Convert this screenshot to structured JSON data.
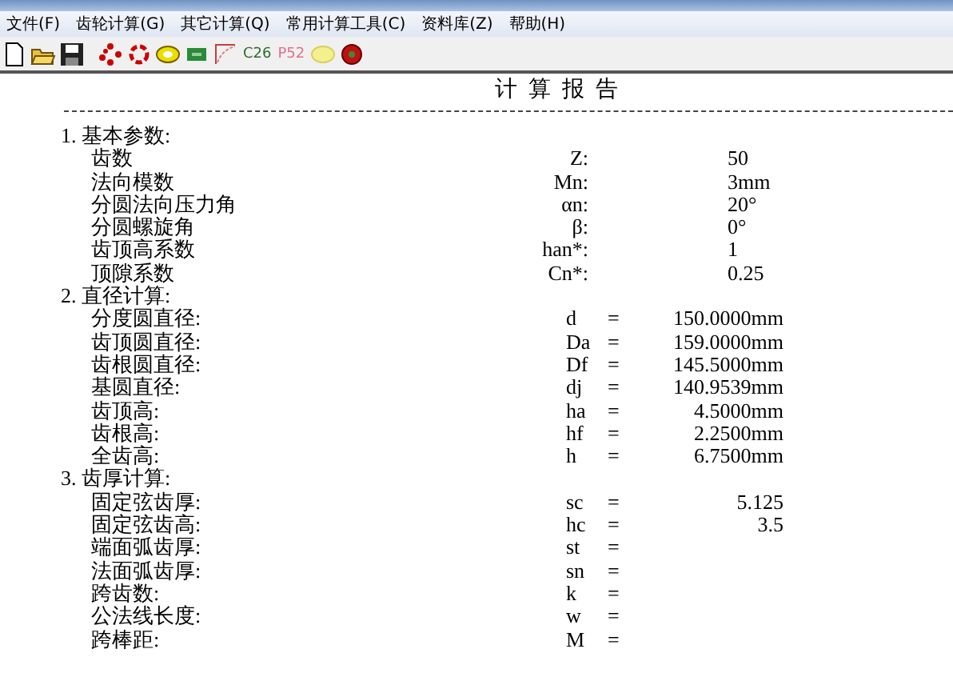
{
  "menu": [
    "文件(F)",
    "齿轮计算(G)",
    "其它计算(Q)",
    "常用计算工具(C)",
    "资料库(Z)",
    "帮助(H)"
  ],
  "toolbar": [
    {
      "kind": "new"
    },
    {
      "kind": "open"
    },
    {
      "kind": "save"
    },
    {
      "kind": "dots"
    },
    {
      "kind": "ring"
    },
    {
      "kind": "yellow"
    },
    {
      "kind": "green"
    },
    {
      "kind": "curve"
    },
    {
      "kind": "text",
      "text": "C26",
      "color": "#2e6b2e"
    },
    {
      "kind": "text",
      "text": "P52",
      "color": "#e07090"
    },
    {
      "kind": "yellow-pale"
    },
    {
      "kind": "red"
    }
  ],
  "report": {
    "title": "计  算  报  告",
    "sections": [
      {
        "heading": "1. 基本参数:",
        "kind": "colon",
        "rows": [
          {
            "label": "齿数",
            "symbol": "Z:",
            "value": "50"
          },
          {
            "label": "法向模数",
            "symbol": "Mn:",
            "value": "3mm"
          },
          {
            "label": "分圆法向压力角",
            "symbol": "αn:",
            "value": "20°"
          },
          {
            "label": "分圆螺旋角",
            "symbol": "β:",
            "value": "0°"
          },
          {
            "label": "齿顶高系数",
            "symbol": "han*:",
            "value": "1"
          },
          {
            "label": "顶隙系数",
            "symbol": "Cn*:",
            "value": "0.25"
          }
        ]
      },
      {
        "heading": "2. 直径计算:",
        "kind": "equals",
        "rows": [
          {
            "label": "分度圆直径:",
            "symbol": "d",
            "sep": "=",
            "value": "150.0000mm"
          },
          {
            "label": "齿顶圆直径:",
            "symbol": "Da",
            "sep": "=",
            "value": "159.0000mm"
          },
          {
            "label": "齿根圆直径:",
            "symbol": "Df",
            "sep": "=",
            "value": "145.5000mm"
          },
          {
            "label": "基圆直径:",
            "symbol": "dj",
            "sep": "=",
            "value": "140.9539mm"
          },
          {
            "label": "齿顶高:",
            "symbol": "ha",
            "sep": "=",
            "value": "4.5000mm"
          },
          {
            "label": "齿根高:",
            "symbol": "hf",
            "sep": "=",
            "value": "2.2500mm"
          },
          {
            "label": "全齿高:",
            "symbol": "h",
            "sep": "=",
            "value": "6.7500mm"
          }
        ]
      },
      {
        "heading": "3. 齿厚计算:",
        "kind": "equals",
        "rows": [
          {
            "label": "固定弦齿厚:",
            "symbol": "sc",
            "sep": "=",
            "value": "5.125"
          },
          {
            "label": "固定弦齿高:",
            "symbol": "hc",
            "sep": "=",
            "value": "3.5"
          },
          {
            "label": "端面弧齿厚:",
            "symbol": "st",
            "sep": "="
          },
          {
            "label": "法面弧齿厚:",
            "symbol": "sn",
            "sep": "="
          },
          {
            "label": "跨齿数:",
            "symbol": "k",
            "sep": "="
          },
          {
            "label": "公法线长度:",
            "symbol": "w",
            "sep": "="
          },
          {
            "label": "跨棒距:",
            "symbol": "M",
            "sep": "="
          }
        ]
      }
    ]
  }
}
